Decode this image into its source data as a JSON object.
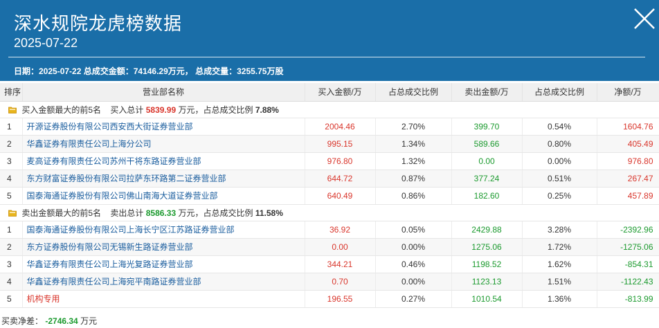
{
  "header": {
    "title": "深水规院龙虎榜数据",
    "date": "2025-07-22",
    "summary": "日期：2025-07-22 总成交金额：74146.29万元， 总成交量：3255.75万股"
  },
  "columns": [
    "排序",
    "营业部名称",
    "买入金额/万",
    "占总成交比例",
    "卖出金额/万",
    "占总成交比例",
    "净额/万"
  ],
  "buy_group": {
    "label": "买入金额最大的前5名",
    "total_prefix": "买入总计",
    "total_value": "5839.99",
    "total_unit": "万元，占总成交比例",
    "ratio": "7.88%"
  },
  "buy_rows": [
    {
      "rank": "1",
      "name": "开源证券股份有限公司西安西大街证券营业部",
      "buy": "2004.46",
      "buy_pct": "2.70%",
      "sell": "399.70",
      "sell_pct": "0.54%",
      "net": "1604.76"
    },
    {
      "rank": "2",
      "name": "华鑫证券有限责任公司上海分公司",
      "buy": "995.15",
      "buy_pct": "1.34%",
      "sell": "589.66",
      "sell_pct": "0.80%",
      "net": "405.49"
    },
    {
      "rank": "3",
      "name": "麦高证券有限责任公司苏州干将东路证券营业部",
      "buy": "976.80",
      "buy_pct": "1.32%",
      "sell": "0.00",
      "sell_pct": "0.00%",
      "net": "976.80"
    },
    {
      "rank": "4",
      "name": "东方财富证券股份有限公司拉萨东环路第二证券营业部",
      "buy": "644.72",
      "buy_pct": "0.87%",
      "sell": "377.24",
      "sell_pct": "0.51%",
      "net": "267.47"
    },
    {
      "rank": "5",
      "name": "国泰海通证券股份有限公司佛山南海大道证券营业部",
      "buy": "640.49",
      "buy_pct": "0.86%",
      "sell": "182.60",
      "sell_pct": "0.25%",
      "net": "457.89"
    }
  ],
  "sell_group": {
    "label": "卖出金额最大的前5名",
    "total_prefix": "卖出总计",
    "total_value": "8586.33",
    "total_unit": "万元，占总成交比例",
    "ratio": "11.58%"
  },
  "sell_rows": [
    {
      "rank": "1",
      "name": "国泰海通证券股份有限公司上海长宁区江苏路证券营业部",
      "buy": "36.92",
      "buy_pct": "0.05%",
      "sell": "2429.88",
      "sell_pct": "3.28%",
      "net": "-2392.96"
    },
    {
      "rank": "2",
      "name": "东方证券股份有限公司无锡新生路证券营业部",
      "buy": "0.00",
      "buy_pct": "0.00%",
      "sell": "1275.06",
      "sell_pct": "1.72%",
      "net": "-1275.06"
    },
    {
      "rank": "3",
      "name": "华鑫证券有限责任公司上海光复路证券营业部",
      "buy": "344.21",
      "buy_pct": "0.46%",
      "sell": "1198.52",
      "sell_pct": "1.62%",
      "net": "-854.31"
    },
    {
      "rank": "4",
      "name": "华鑫证券有限责任公司上海宛平南路证券营业部",
      "buy": "0.70",
      "buy_pct": "0.00%",
      "sell": "1123.13",
      "sell_pct": "1.51%",
      "net": "-1122.43"
    },
    {
      "rank": "5",
      "name": "机构专用",
      "buy": "196.55",
      "buy_pct": "0.27%",
      "sell": "1010.54",
      "sell_pct": "1.36%",
      "net": "-813.99",
      "name_red": true
    }
  ],
  "footer": {
    "label": "买卖净差：",
    "value": "-2746.34",
    "unit": "万元"
  },
  "icons": {
    "close": "close-icon",
    "group": "folder-icon"
  },
  "colors": {
    "header_bg": "#1a6ea8",
    "up_red": "#d9352b",
    "down_green": "#1b9a2e",
    "link_blue": "#1a5d9e",
    "group_icon": "#e8b51c"
  }
}
